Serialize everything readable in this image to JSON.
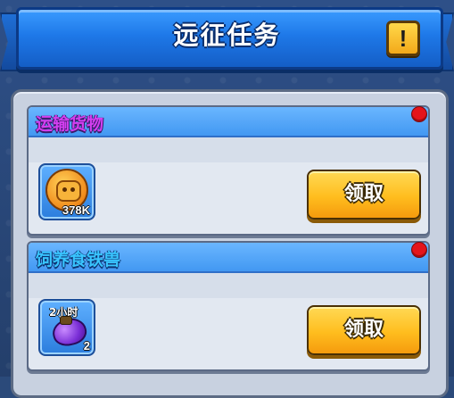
{
  "header": {
    "title": "远征任务",
    "info_label": "!"
  },
  "tasks": [
    {
      "title": "运输货物",
      "title_color": "#d43ff0",
      "reward": {
        "icon": "paw-coin-icon",
        "quantity": "378K"
      },
      "claim_label": "领取",
      "has_notification": true
    },
    {
      "title": "饲养食铁兽",
      "title_color": "#39c5ff",
      "reward": {
        "icon": "purple-egg-icon",
        "duration": "2小时",
        "quantity": "2"
      },
      "claim_label": "领取",
      "has_notification": true
    }
  ],
  "colors": {
    "header_blue": "#1e78e8",
    "button_gold": "#ffbd1e",
    "notification_red": "#e4141b"
  }
}
